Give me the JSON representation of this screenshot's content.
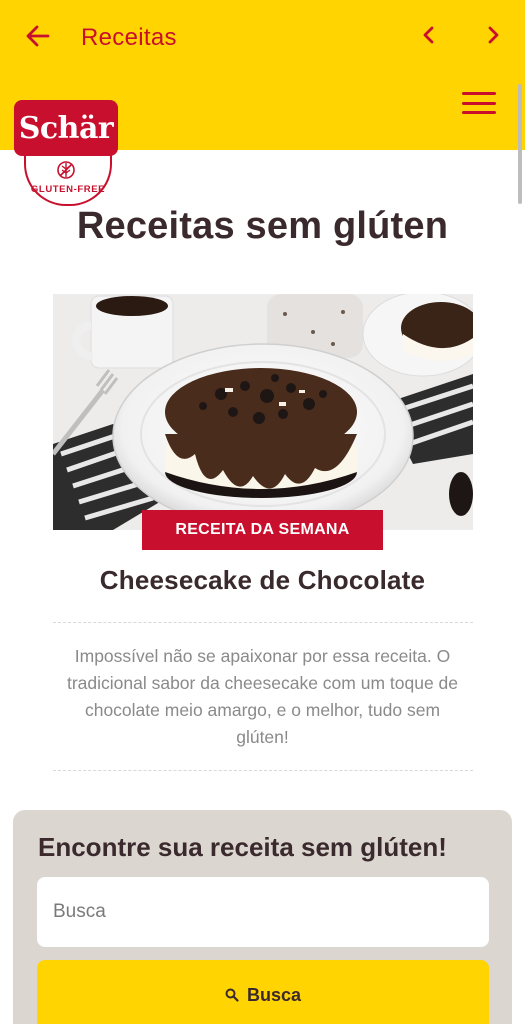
{
  "appbar": {
    "title": "Receitas",
    "back_icon": "arrow-left-icon",
    "prev_icon": "chevron-left-icon",
    "next_icon": "chevron-right-icon",
    "menu_icon": "hamburger-menu-icon"
  },
  "logo": {
    "brand": "Schär",
    "tagline": "GLUTEN-FREE"
  },
  "page": {
    "title": "Receitas sem glúten"
  },
  "featured": {
    "badge": "RECEITA DA SEMANA",
    "title": "Cheesecake de Chocolate",
    "description": "Impossível não se apaixonar por essa receita. O tradicional sabor da cheesecake com um toque de chocolate meio amargo, e o melhor, tudo sem glúten!"
  },
  "search": {
    "heading": "Encontre sua receita sem glúten!",
    "placeholder": "Busca",
    "button_label": "Busca",
    "button_icon": "search-icon"
  },
  "colors": {
    "brand_yellow": "#ffd400",
    "brand_red": "#c8102e",
    "text_dark": "#3a2a2d",
    "card_bg": "#dcd6d0"
  }
}
